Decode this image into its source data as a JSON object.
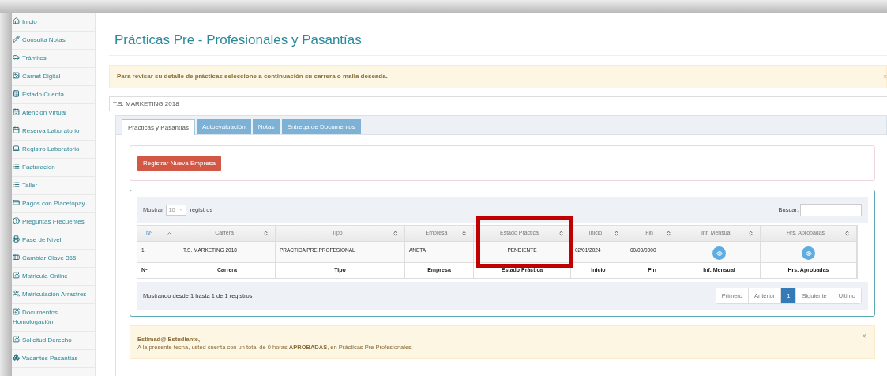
{
  "sidebar": {
    "items": [
      {
        "label": "Inicio"
      },
      {
        "label": "Consulta Notas"
      },
      {
        "label": "Trámites"
      },
      {
        "label": "Carnet Digital"
      },
      {
        "label": "Estado Cuenta"
      },
      {
        "label": "Atención Virtual"
      },
      {
        "label": "Reserva Laboratorio"
      },
      {
        "label": "Registro Laboratorio"
      },
      {
        "label": "Facturacion"
      },
      {
        "label": "Taller"
      },
      {
        "label": "Pagos con Placetopay"
      },
      {
        "label": "Preguntas Frecuentes"
      },
      {
        "label": "Pase de Nivel"
      },
      {
        "label": "Cambiar Clave 365"
      },
      {
        "label": "Matricula Online"
      },
      {
        "label": "Matriculación Arrastres"
      },
      {
        "label": "Documentos Homologación"
      },
      {
        "label": "Solicitud Derecho"
      },
      {
        "label": "Vacantes Pasantías"
      }
    ]
  },
  "page_title": "Prácticas Pre - Profesionales y Pasantías",
  "notice": {
    "text": "Para revisar su detalle de prácticas seleccione a continuación su carrera o malla deseada.",
    "close": "×"
  },
  "career_select": {
    "value": "T.S. MARKETING 2018"
  },
  "tabs": [
    {
      "label": "Prácticas y Pasantías",
      "selected": true
    },
    {
      "label": "Autoevaluación",
      "selected": false
    },
    {
      "label": "Notas",
      "selected": false
    },
    {
      "label": "Entrega de Documentos",
      "selected": false
    }
  ],
  "register_button": "Registrar Nueva Empresa",
  "table": {
    "length": {
      "prefix": "Mostrar",
      "value": "10",
      "suffix": "registros"
    },
    "search": {
      "label": "Buscar:"
    },
    "columns": [
      {
        "label": "Nº",
        "sorted": true,
        "highlighted": false
      },
      {
        "label": "Carrera",
        "sorted": false,
        "highlighted": false
      },
      {
        "label": "Tipo",
        "sorted": false,
        "highlighted": false
      },
      {
        "label": "Empresa",
        "sorted": false,
        "highlighted": false
      },
      {
        "label": "Estado Práctica",
        "sorted": false,
        "highlighted": true
      },
      {
        "label": "Inicio",
        "sorted": false,
        "highlighted": false
      },
      {
        "label": "Fin",
        "sorted": false,
        "highlighted": false
      },
      {
        "label": "Inf. Mensual",
        "sorted": false,
        "highlighted": false
      },
      {
        "label": "Hrs. Aprobadas",
        "sorted": false,
        "highlighted": false
      }
    ],
    "rows": [
      {
        "cells": [
          {
            "kind": "text",
            "text": "1"
          },
          {
            "kind": "text",
            "text": "T.S. MARKETING 2018"
          },
          {
            "kind": "text",
            "text": "PRACTICA PRE PROFESIONAL"
          },
          {
            "kind": "text",
            "text": "ANETA"
          },
          {
            "kind": "center",
            "text": "PENDIENTE"
          },
          {
            "kind": "text",
            "text": "02/01/2024"
          },
          {
            "kind": "text",
            "text": "00/00/0000"
          },
          {
            "kind": "view"
          },
          {
            "kind": "view"
          }
        ]
      }
    ],
    "footer": [
      "Nº",
      "Carrera",
      "Tipo",
      "Empresa",
      "Estado Práctica",
      "Inicio",
      "Fin",
      "Inf. Mensual",
      "Hrs. Aprobadas"
    ],
    "info": "Mostrando desde 1 hasta 1 de 1 registros",
    "pagination": [
      {
        "label": "Primero",
        "selected": false
      },
      {
        "label": "Anterior",
        "selected": false
      },
      {
        "label": "1",
        "selected": true
      },
      {
        "label": "Siguiente",
        "selected": false
      },
      {
        "label": "Ultimo",
        "selected": false
      }
    ]
  },
  "summary": {
    "title": "Estimad@ Estudiante,",
    "text": "A la presente fecha, usted cuenta con un total de 0 horas **APROBADAS**, en Prácticas Pre Profesionales.",
    "close": "×"
  }
}
